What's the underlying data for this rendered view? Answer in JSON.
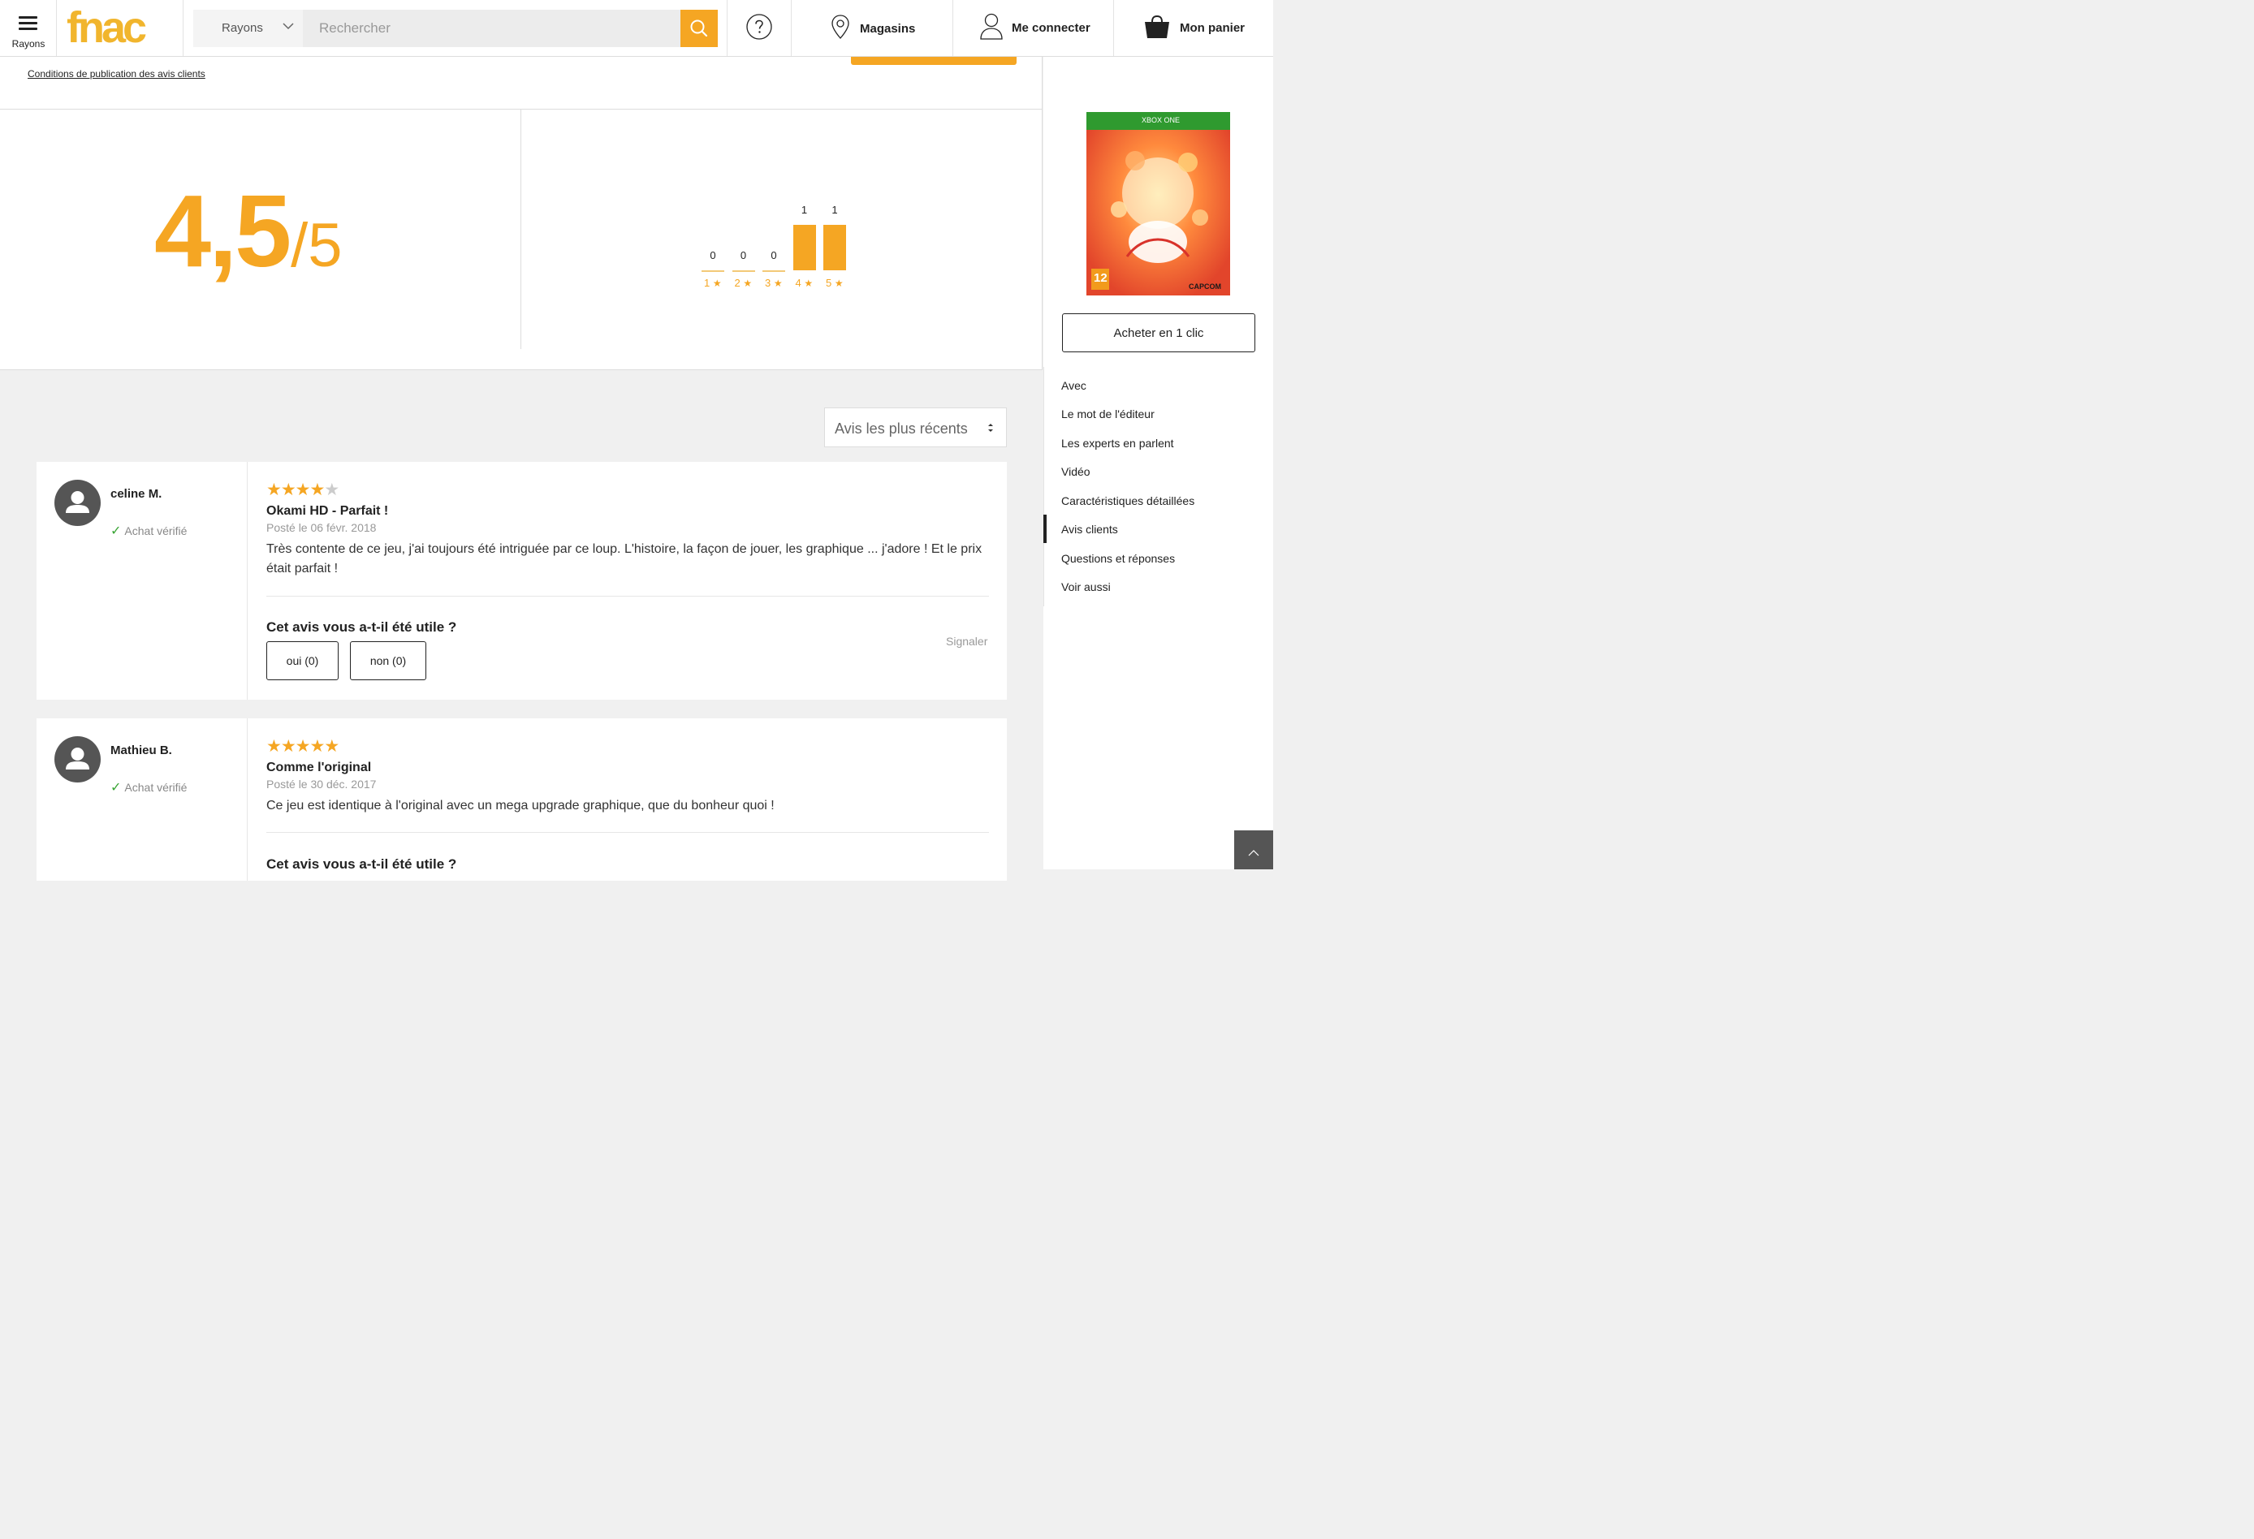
{
  "header": {
    "menu_label": "Rayons",
    "logo_text": "fnac",
    "rayons_label": "Rayons",
    "search_placeholder": "Rechercher",
    "stores_label": "Magasins",
    "login_label": "Me connecter",
    "cart_label": "Mon panier"
  },
  "summary": {
    "conditions_link": "Conditions de publication des avis clients",
    "score": "4,5",
    "score_max": "/5"
  },
  "chart_data": {
    "type": "bar",
    "categories": [
      "1",
      "2",
      "3",
      "4",
      "5"
    ],
    "values": [
      0,
      0,
      0,
      1,
      1
    ],
    "ylim": [
      0,
      1
    ]
  },
  "sort": {
    "label": "Avis les plus récents"
  },
  "reviews": [
    {
      "author": "celine M.",
      "verified": "Achat vérifié",
      "rating": 4,
      "title": "Okami HD - Parfait !",
      "date": "Posté le 06 févr. 2018",
      "text": "Très contente de ce jeu, j'ai toujours été intriguée par ce loup. L'histoire, la façon de jouer, les graphique ... j'adore ! Et le prix était parfait !",
      "useful_question": "Cet avis vous a-t-il été utile ?",
      "yes_label": "oui (0)",
      "no_label": "non (0)",
      "report_label": "Signaler"
    },
    {
      "author": "Mathieu B.",
      "verified": "Achat vérifié",
      "rating": 5,
      "title": "Comme l'original",
      "date": "Posté le 30 déc. 2017",
      "text": "Ce jeu est identique à l'original avec un mega upgrade graphique, que du bonheur quoi !",
      "useful_question": "Cet avis vous a-t-il été utile ?"
    }
  ],
  "sidebar": {
    "box_platform": "XBOX ONE",
    "box_age_rating": "12",
    "box_publisher": "CAPCOM",
    "buy_label": "Acheter en 1 clic",
    "nav": [
      "Avec",
      "Le mot de l'éditeur",
      "Les experts en parlent",
      "Vidéo",
      "Caractéristiques détaillées",
      "Avis clients",
      "Questions et réponses",
      "Voir aussi"
    ],
    "active_index": 5
  },
  "colors": {
    "accent": "#f5a623",
    "star_off": "#cccccc",
    "verified": "#3aa535"
  }
}
